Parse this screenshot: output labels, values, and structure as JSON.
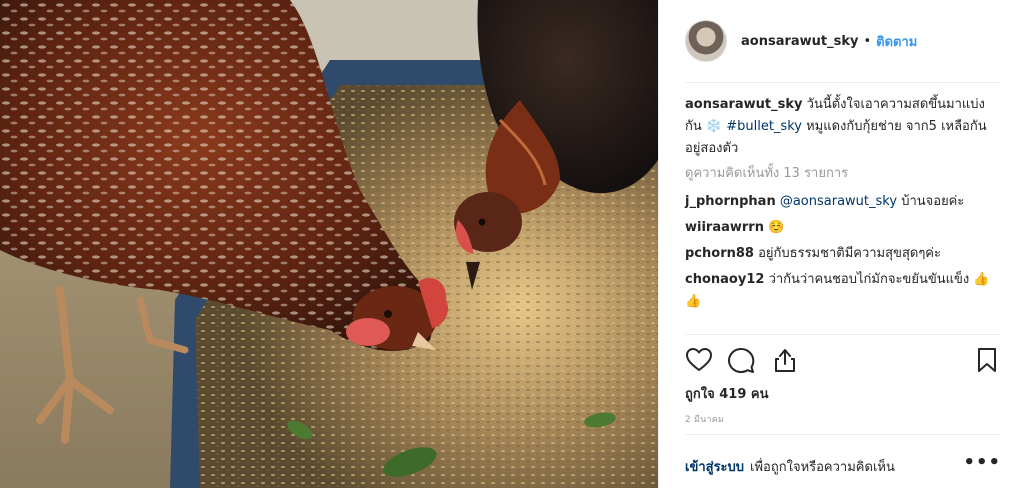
{
  "post": {
    "username": "aonsarawut_sky",
    "separator": "•",
    "follow_label": "ติดตาม",
    "caption": {
      "username": "aonsarawut_sky",
      "text_before": "วันนี้ตั้งใจเอาความสดขึ้นมาแบ่งกัน ❄️",
      "hashtag": "#bullet_sky",
      "text_after": "หมูแดงกับกุ้ยช่าย จาก5 เหลือกันอยู่สองตัว"
    },
    "view_all_comments": "ดูความคิดเห็นทั้ง 13 รายการ",
    "comments": [
      {
        "username": "j_phornphan",
        "mention": "@aonsarawut_sky",
        "text": "บ้านจอยค่ะ"
      },
      {
        "username": "wiiraawrrn",
        "mention": "",
        "text": "☺️"
      },
      {
        "username": "pchorn88",
        "mention": "",
        "text": "อยู่กับธรรมชาติมีความสุขสุดๆค่ะ"
      },
      {
        "username": "chonaoy12",
        "mention": "",
        "text": "ว่ากันว่าคนชอบไก่มักจะขยันขันแข็ง 👍👍"
      }
    ],
    "likes_text": "ถูกใจ 419 คน",
    "date_text": "2 มีนาคม",
    "login_label": "เข้าสู่ระบบ",
    "login_hint": "เพื่อถูกใจหรือความคิดเห็น",
    "more_label": "•••"
  },
  "icons": {
    "like": "heart-icon",
    "comment": "comment-bubble-icon",
    "share": "share-icon",
    "save": "bookmark-icon",
    "more": "more-options-icon"
  },
  "colors": {
    "link_blue": "#3897f0",
    "dark_link": "#003569",
    "muted_text": "#999999",
    "divider": "#efefef"
  }
}
